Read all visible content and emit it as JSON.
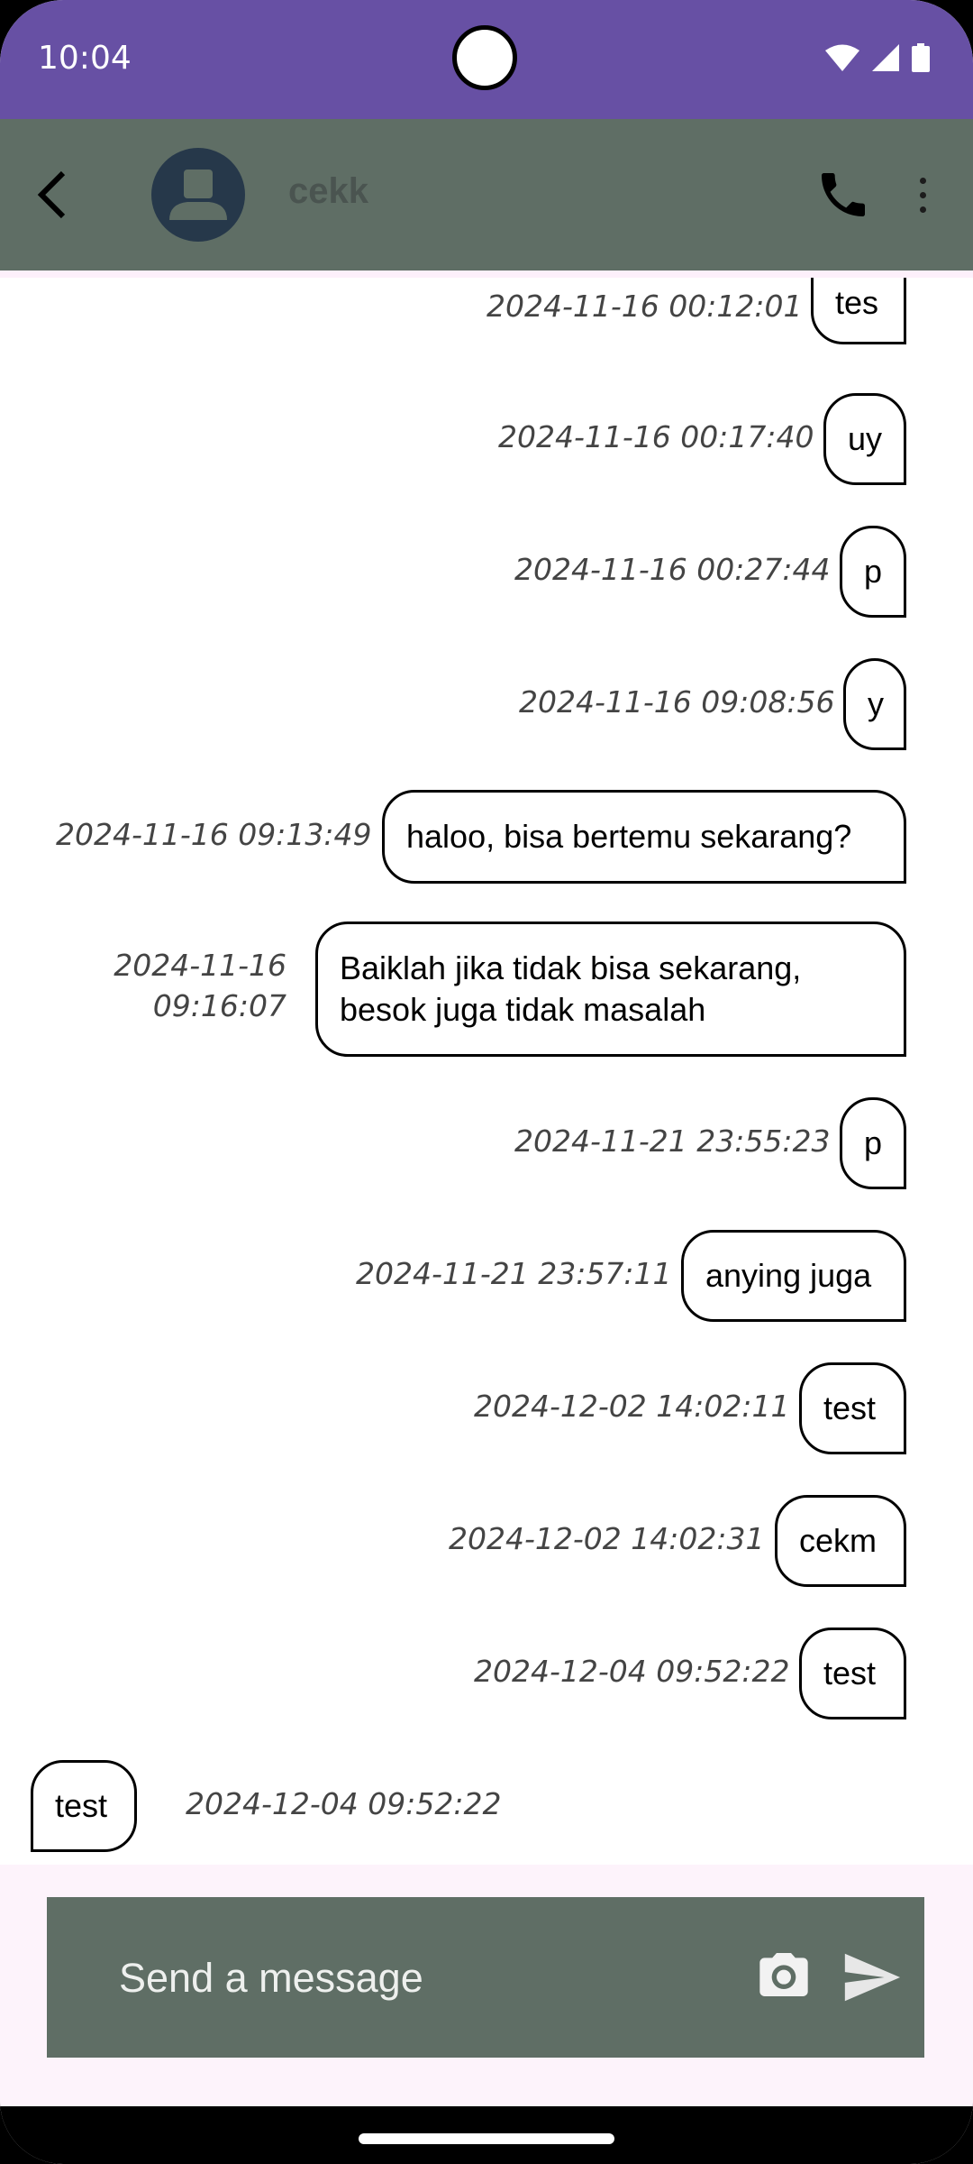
{
  "status_bar": {
    "time": "10:04",
    "icons": [
      "wifi-icon",
      "signal-icon",
      "battery-icon"
    ]
  },
  "header": {
    "contact_name": "cekk",
    "icons": [
      "back-arrow-icon",
      "avatar-icon",
      "phone-icon",
      "more-vert-icon"
    ]
  },
  "colors": {
    "status_bar": "#6750a4",
    "app_bar": "#5f6e65",
    "composer": "#5f6e65",
    "input_area_bg": "#fdf3fb"
  },
  "messages": [
    {
      "text": "tes",
      "time": "2024-11-16 00:12:01",
      "direction": "out"
    },
    {
      "text": "uy",
      "time": "2024-11-16 00:17:40",
      "direction": "out"
    },
    {
      "text": "p",
      "time": "2024-11-16 00:27:44",
      "direction": "out"
    },
    {
      "text": "y",
      "time": "2024-11-16 09:08:56",
      "direction": "out"
    },
    {
      "text": "haloo, bisa bertemu sekarang?",
      "time": "2024-11-16 09:13:49",
      "direction": "out"
    },
    {
      "text": "Baiklah jika tidak bisa sekarang, besok juga tidak masalah",
      "time": "2024-11-16 09:16:07",
      "direction": "out"
    },
    {
      "text": "p",
      "time": "2024-11-21 23:55:23",
      "direction": "out"
    },
    {
      "text": "anying juga",
      "time": "2024-11-21 23:57:11",
      "direction": "out"
    },
    {
      "text": "test",
      "time": "2024-12-02 14:02:11",
      "direction": "out"
    },
    {
      "text": "cekm",
      "time": "2024-12-02 14:02:31",
      "direction": "out"
    },
    {
      "text": "test",
      "time": "2024-12-04 09:52:22",
      "direction": "out"
    },
    {
      "text": "test",
      "time": "2024-12-04 09:52:22",
      "direction": "in"
    }
  ],
  "composer": {
    "placeholder": "Send a message",
    "icons": [
      "camera-icon",
      "send-icon"
    ]
  }
}
